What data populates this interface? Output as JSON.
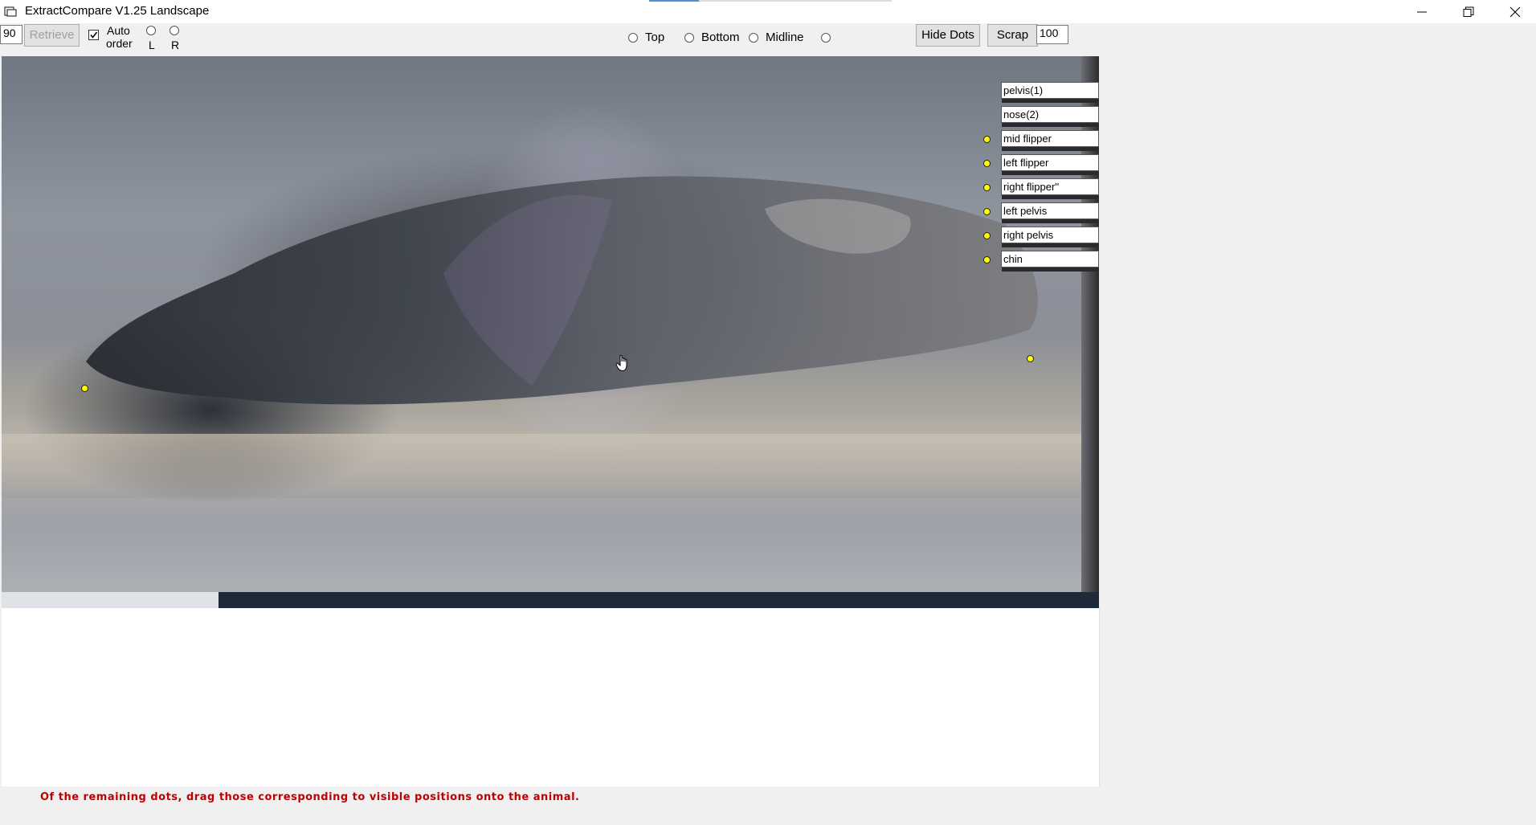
{
  "window": {
    "title": "ExtractCompare V1.25 Landscape",
    "icons": {
      "app": "app-icon",
      "minimize": "minimize-icon",
      "restore": "restore-icon",
      "close": "close-icon"
    }
  },
  "toolbar": {
    "angle_value": "90",
    "retrieve_label": "Retrieve",
    "retrieve_enabled": false,
    "auto_order_checked": true,
    "auto_order_label_line1": "Auto",
    "auto_order_label_line2": "order",
    "side_left_label": "L",
    "side_right_label": "R",
    "view_options": [
      "Top",
      "Bottom",
      "Midline",
      ""
    ],
    "hide_dots_label": "Hide Dots",
    "scrap_label": "Scrap",
    "scale_value": "100"
  },
  "point_labels": [
    {
      "text": "pelvis(1)",
      "has_dot": false
    },
    {
      "text": "nose(2)",
      "has_dot": false
    },
    {
      "text": "mid flipper",
      "has_dot": true
    },
    {
      "text": "left flipper",
      "has_dot": true
    },
    {
      "text": "right flipper''",
      "has_dot": true
    },
    {
      "text": "left pelvis",
      "has_dot": true
    },
    {
      "text": "right pelvis",
      "has_dot": true
    },
    {
      "text": "chin",
      "has_dot": true
    }
  ],
  "placed_points": [
    {
      "name": "nose-point"
    },
    {
      "name": "pelvis-point"
    }
  ],
  "status_message": "Of the remaining dots, drag those corresponding to visible positions onto the animal.",
  "colors": {
    "dot": "#ffff00",
    "status_text": "#c00000"
  }
}
